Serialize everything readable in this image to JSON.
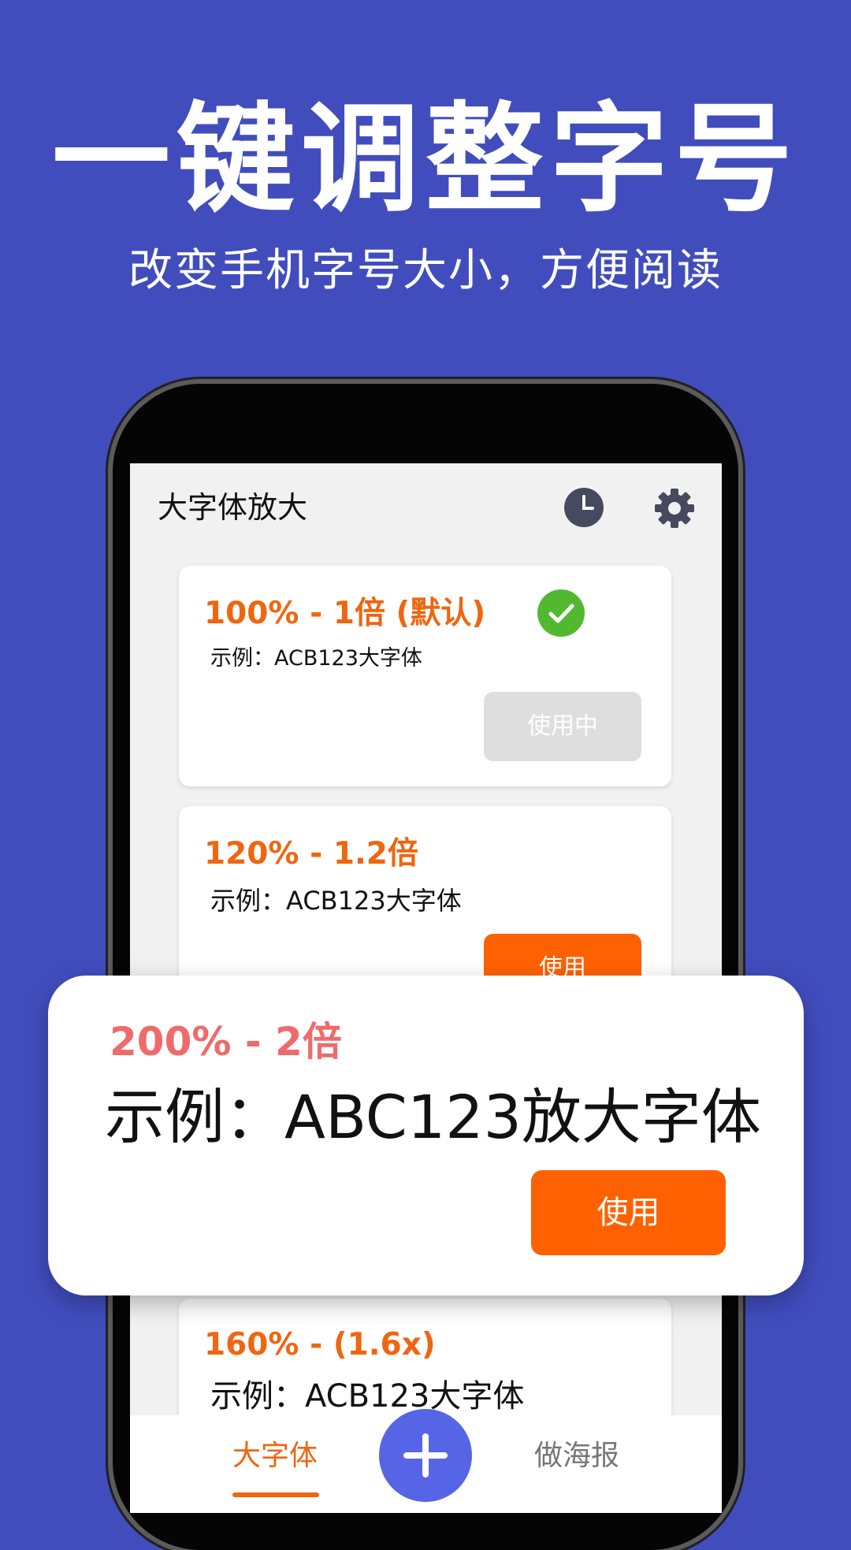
{
  "promo": {
    "headline": "一键调整字号",
    "subheadline": "改变手机字号大小，方便阅读"
  },
  "app": {
    "title": "大字体放大",
    "icons": {
      "history": "clock-icon",
      "settings": "gear-icon",
      "selected": "check-icon",
      "add": "plus-icon"
    }
  },
  "cards": [
    {
      "title": "100% - 1倍 (默认)",
      "sample": "示例：ACB123大字体",
      "button": "使用中",
      "active": true
    },
    {
      "title": "120% - 1.2倍",
      "sample": "示例：ACB123大字体",
      "button": "使用",
      "active": false
    },
    {
      "title": "160% - (1.6x)",
      "sample": "示例：ACB123大字体"
    }
  ],
  "popup": {
    "title": "200% - 2倍",
    "sample": "示例：ABC123放大字体",
    "button": "使用"
  },
  "nav": {
    "tabs": [
      {
        "label": "大字体",
        "active": true
      },
      {
        "label": "做海报",
        "active": false
      }
    ]
  },
  "colors": {
    "background": "#414dbd",
    "accent": "#ff6100",
    "title_orange": "#f0650f",
    "popup_title": "#ef6b6b",
    "fab": "#5665e6",
    "check": "#52b830"
  }
}
